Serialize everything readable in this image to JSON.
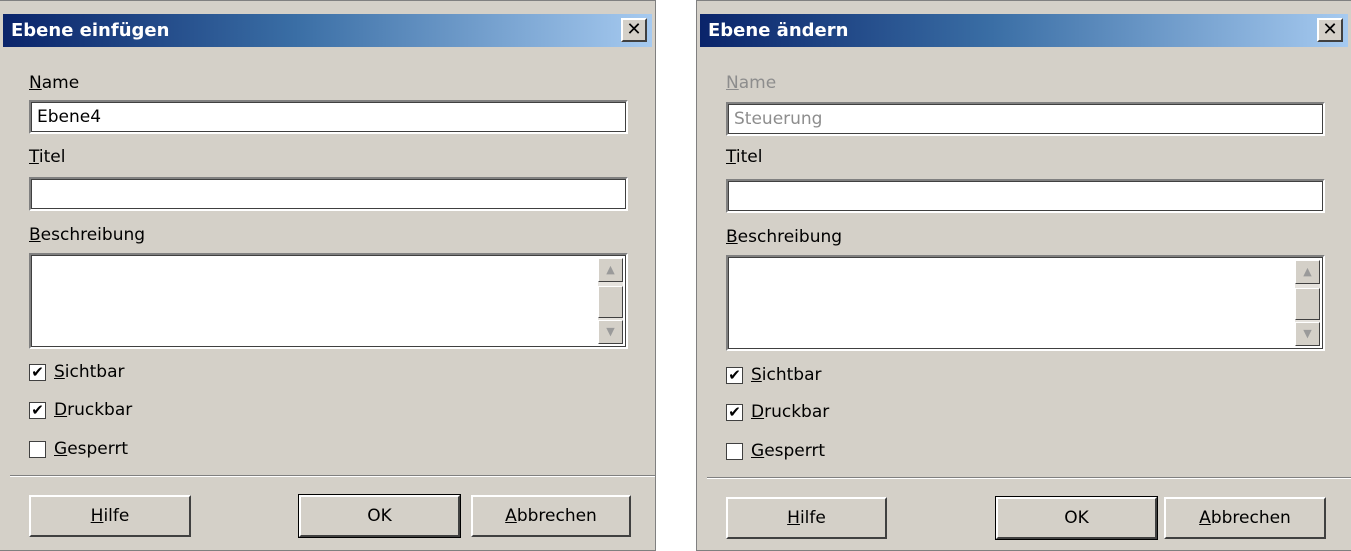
{
  "insert": {
    "title": "Ebene einfügen",
    "close_glyph": "✕",
    "name_label_mnemonic": "N",
    "name_label_rest": "ame",
    "name_value": "Ebene4",
    "title_label_mnemonic": "T",
    "title_label_rest": "itel",
    "title_value": "",
    "description_label_mnemonic": "B",
    "description_label_rest": "eschreibung",
    "description_value": "",
    "visible_mnemonic": "S",
    "visible_rest": "ichtbar",
    "visible_checked": true,
    "printable_mnemonic": "D",
    "printable_rest": "ruckbar",
    "printable_checked": true,
    "locked_mnemonic": "G",
    "locked_rest": "esperrt",
    "locked_checked": false,
    "help_mnemonic": "H",
    "help_rest": "ilfe",
    "ok_label": "OK",
    "cancel_mnemonic": "A",
    "cancel_rest": "bbrechen"
  },
  "modify": {
    "title": "Ebene ändern",
    "close_glyph": "✕",
    "name_label_mnemonic": "N",
    "name_label_rest": "ame",
    "name_value": "Steuerung",
    "title_label_mnemonic": "T",
    "title_label_rest": "itel",
    "title_value": "",
    "description_label_mnemonic": "B",
    "description_label_rest": "eschreibung",
    "description_value": "",
    "visible_mnemonic": "S",
    "visible_rest": "ichtbar",
    "visible_checked": true,
    "printable_mnemonic": "D",
    "printable_rest": "ruckbar",
    "printable_checked": true,
    "locked_mnemonic": "G",
    "locked_rest": "esperrt",
    "locked_checked": false,
    "help_mnemonic": "H",
    "help_rest": "ilfe",
    "ok_label": "OK",
    "cancel_mnemonic": "A",
    "cancel_rest": "bbrechen"
  },
  "icons": {
    "check_glyph": "✔",
    "scroll_up": "▲",
    "scroll_down": "▼"
  },
  "colors": {
    "dialog_bg": "#d4d0c8",
    "title_gradient_start": "#0a246a",
    "title_gradient_end": "#a6caf0",
    "disabled_text": "#8d8d8d"
  }
}
